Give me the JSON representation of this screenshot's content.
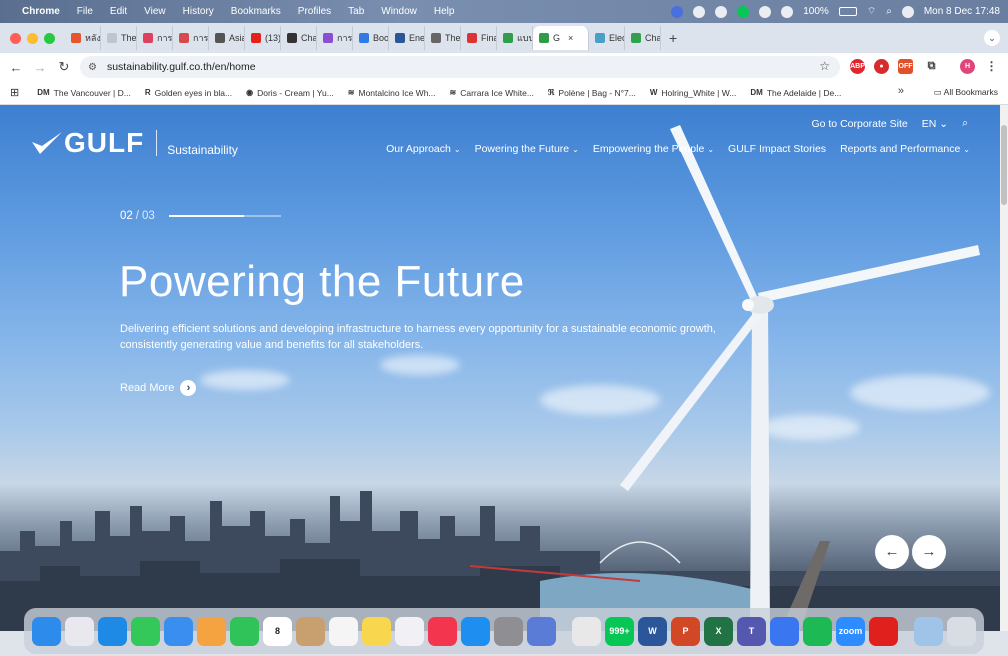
{
  "menubar": {
    "app": "Chrome",
    "items": [
      "File",
      "Edit",
      "View",
      "History",
      "Bookmarks",
      "Profiles",
      "Tab",
      "Window",
      "Help"
    ],
    "battery": "100%",
    "datetime": "Mon 8 Dec  17:48"
  },
  "tabs": [
    {
      "label": "หลังจา",
      "color": "#e8552d"
    },
    {
      "label": "The a",
      "color": "#c0c4cc"
    },
    {
      "label": "การแ",
      "color": "#e04060"
    },
    {
      "label": "การผ",
      "color": "#d94a4a"
    },
    {
      "label": "Asia-",
      "color": "#555"
    },
    {
      "label": "(13) ",
      "color": "#e62117"
    },
    {
      "label": "Chatt",
      "color": "#333"
    },
    {
      "label": "การนิ",
      "color": "#8a4fd0"
    },
    {
      "label": "Book",
      "color": "#2f7be6"
    },
    {
      "label": "Energ",
      "color": "#2b579a"
    },
    {
      "label": "The C",
      "color": "#666"
    },
    {
      "label": "Final_",
      "color": "#d33"
    },
    {
      "label": "แบบ ",
      "color": "#2e9e48"
    },
    {
      "label": "G",
      "color": "#2e9e48",
      "active": true
    },
    {
      "label": "Electi",
      "color": "#48a0c8"
    },
    {
      "label": "Chat",
      "color": "#31a24c"
    }
  ],
  "new_tab_label": "+",
  "address": {
    "url": "sustainability.gulf.co.th/en/home"
  },
  "bookmarks": [
    {
      "icon": "DM",
      "label": "The Vancouver | D..."
    },
    {
      "icon": "R",
      "label": "Golden eyes in bla..."
    },
    {
      "icon": "◉",
      "label": "Doris - Cream | Yu..."
    },
    {
      "icon": "≋",
      "label": "Montalcino Ice Wh..."
    },
    {
      "icon": "≋",
      "label": "Carrara Ice White..."
    },
    {
      "icon": "ℜ",
      "label": "Polène | Bag - N°7..."
    },
    {
      "icon": "W",
      "label": "Holring_White | W..."
    },
    {
      "icon": "DM",
      "label": "The Adelaide | De..."
    }
  ],
  "bookmarks_more": "»",
  "all_bookmarks": "All Bookmarks",
  "site": {
    "logo_word": "GULF",
    "logo_sub": "Sustainability",
    "top_links": {
      "corporate": "Go to Corporate Site",
      "lang": "EN"
    },
    "nav": [
      "Our Approach",
      "Powering the Future",
      "Empowering the People",
      "GULF Impact Stories",
      "Reports and Performance"
    ],
    "slide_current": "02",
    "slide_sep": "/",
    "slide_total": "03",
    "slide_progress": 0.67,
    "hero_title": "Powering the Future",
    "hero_desc": "Delivering efficient solutions and developing infrastructure to harness every opportunity for a sustainable economic growth, consistently generating value and benefits for all stakeholders.",
    "read_more": "Read More",
    "prev": "←",
    "next": "→"
  },
  "extensions": [
    {
      "label": "ABP",
      "color": "#e0262c"
    },
    {
      "label": "●",
      "color": "#d82b2b"
    },
    {
      "label": "OFF",
      "color": "#e2502a"
    }
  ],
  "profile_initial": "H",
  "dock": [
    {
      "name": "finder",
      "color": "#2d8ceb",
      "label": ""
    },
    {
      "name": "launchpad",
      "color": "#e8e8ee",
      "label": ""
    },
    {
      "name": "safari",
      "color": "#1e8ae6",
      "label": ""
    },
    {
      "name": "messages",
      "color": "#34c759",
      "label": ""
    },
    {
      "name": "mail",
      "color": "#3a8ef0",
      "label": ""
    },
    {
      "name": "photos",
      "color": "#f4a340",
      "label": ""
    },
    {
      "name": "facetime",
      "color": "#30c35a",
      "label": ""
    },
    {
      "name": "calendar",
      "color": "#ffffff",
      "label": "8"
    },
    {
      "name": "contacts",
      "color": "#c8a070",
      "label": ""
    },
    {
      "name": "reminders",
      "color": "#f5f5f5",
      "label": ""
    },
    {
      "name": "notes",
      "color": "#f8d64e",
      "label": ""
    },
    {
      "name": "freeform",
      "color": "#f0f0f5",
      "label": ""
    },
    {
      "name": "music",
      "color": "#f3364e",
      "label": ""
    },
    {
      "name": "app-store",
      "color": "#1e8ef0",
      "label": ""
    },
    {
      "name": "system-settings",
      "color": "#8e8e93",
      "label": ""
    },
    {
      "name": "preview",
      "color": "#5a7bd6",
      "label": ""
    },
    {
      "name": "chrome",
      "color": "#e8e8e8",
      "label": ""
    },
    {
      "name": "line",
      "color": "#06c755",
      "label": "999+"
    },
    {
      "name": "word",
      "color": "#2b579a",
      "label": "W"
    },
    {
      "name": "powerpoint",
      "color": "#d24726",
      "label": "P"
    },
    {
      "name": "excel",
      "color": "#217346",
      "label": "X"
    },
    {
      "name": "teams",
      "color": "#5558af",
      "label": "T"
    },
    {
      "name": "signal",
      "color": "#3a76f0",
      "label": ""
    },
    {
      "name": "spotify",
      "color": "#1db954",
      "label": ""
    },
    {
      "name": "zoom",
      "color": "#2d8cff",
      "label": "zoom"
    },
    {
      "name": "acrobat",
      "color": "#e0201c",
      "label": ""
    },
    {
      "name": "downloads",
      "color": "#a0c4e8",
      "label": ""
    },
    {
      "name": "trash",
      "color": "#d8dde4",
      "label": ""
    }
  ]
}
